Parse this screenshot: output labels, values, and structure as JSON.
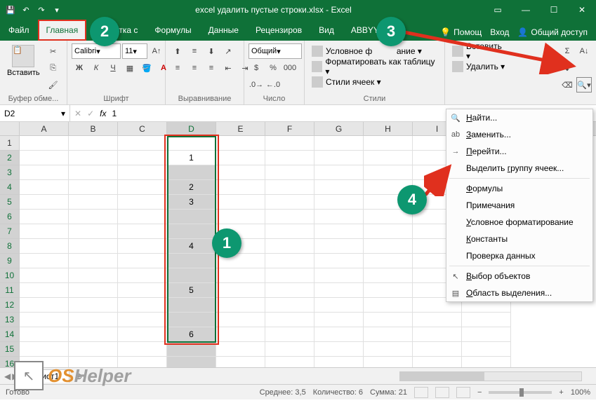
{
  "titlebar": {
    "title": "excel удалить пустые строки.xlsx - Excel",
    "save": "💾",
    "undo": "↶",
    "redo": "↷",
    "min": "—",
    "max": "☐",
    "close": "✕"
  },
  "tabs": {
    "file": "Файл",
    "home": "Главная",
    "layout": "Разметка с",
    "formulas": "Формулы",
    "data": "Данные",
    "review": "Рецензиров",
    "view": "Вид",
    "abbyy": "ABBYY Fine",
    "help": "Помощ",
    "login": "Вход",
    "share": "Общий доступ"
  },
  "ribbon": {
    "paste": "Вставить",
    "clipboard": "Буфер обме...",
    "font_name": "Calibri",
    "font_size": "11",
    "font_group": "Шрифт",
    "align_group": "Выравнивание",
    "number_format": "Общий",
    "number_group": "Число",
    "cond_fmt": "Условное ф",
    "cond_fmt2": "ание ▾",
    "fmt_table": "Форматировать как таблицу ▾",
    "cell_styles": "Стили ячеек ▾",
    "styles_group": "Стили",
    "insert": "Вставить ▾",
    "delete": "Удалить ▾"
  },
  "namebox": {
    "ref": "D2",
    "formula": "1",
    "fx": "fx"
  },
  "columns": [
    "A",
    "B",
    "C",
    "D",
    "E",
    "F",
    "G",
    "H",
    "I",
    "J"
  ],
  "rows_count": 16,
  "selected_col": "D",
  "cell_data": {
    "2": "1",
    "4": "2",
    "5": "3",
    "8": "4",
    "11": "5",
    "14": "6"
  },
  "menu": {
    "find": "Найти...",
    "replace": "Заменить...",
    "goto": "Перейти...",
    "goto_special": "Выделить группу ячеек...",
    "formulas": "Формулы",
    "comments": "Примечания",
    "cond_fmt": "Условное форматирование",
    "constants": "Константы",
    "validation": "Проверка данных",
    "select_obj": "Выбор объектов",
    "sel_pane": "Область выделения..."
  },
  "menu_underline": {
    "find": "Н",
    "replace": "З",
    "goto": "П",
    "goto_special": "г",
    "formulas": "Ф",
    "comments": "П",
    "cond_fmt": "У",
    "constants": "К",
    "select_obj": "В",
    "sel_pane": "О"
  },
  "sheet": {
    "name": "Лист1",
    "add": "⊕"
  },
  "status": {
    "ready": "Готово",
    "avg_label": "Среднее:",
    "avg": "3,5",
    "count_label": "Количество:",
    "count": "6",
    "sum_label": "Сумма:",
    "sum": "21",
    "zoom": "100%"
  },
  "annotations": {
    "n1": "1",
    "n2": "2",
    "n3": "3",
    "n4": "4"
  },
  "logo": {
    "os": "OS",
    "helper": "Helper",
    "arrow": "↖"
  }
}
